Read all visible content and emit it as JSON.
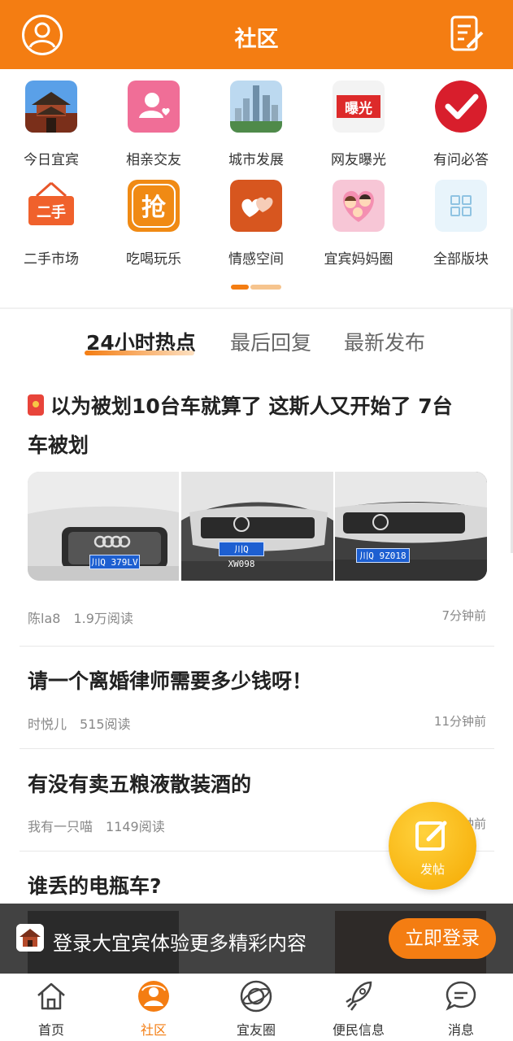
{
  "header": {
    "title": "社区",
    "profile_icon": "user-circle-icon",
    "compose_icon": "edit-note-icon"
  },
  "categories": [
    {
      "label": "今日宜宾",
      "icon": "city-tower-icon"
    },
    {
      "label": "相亲交友",
      "icon": "dating-icon"
    },
    {
      "label": "城市发展",
      "icon": "skyline-icon"
    },
    {
      "label": "网友曝光",
      "icon": "exposure-icon",
      "badge": "曝光"
    },
    {
      "label": "有问必答",
      "icon": "check-icon"
    },
    {
      "label": "二手市场",
      "icon": "second-hand-icon",
      "badge": "二手"
    },
    {
      "label": "吃喝玩乐",
      "icon": "grab-icon",
      "badge": "抢"
    },
    {
      "label": "情感空间",
      "icon": "hearts-icon"
    },
    {
      "label": "宜宾妈妈圈",
      "icon": "family-icon"
    },
    {
      "label": "全部版块",
      "icon": "grid-icon"
    }
  ],
  "tabs": [
    {
      "label": "24小时热点",
      "active": true
    },
    {
      "label": "最后回复",
      "active": false
    },
    {
      "label": "最新发布",
      "active": false
    }
  ],
  "posts": [
    {
      "title_line1": "以为被划10台车就算了  这斯人又开始了 7台",
      "title_line2": "车被划",
      "author": "陈la8",
      "reads": "1.9万阅读",
      "time": "7分钟前",
      "plates": [
        "川Q 379LV",
        "川Q XW098",
        "川Q 9Z018"
      ]
    },
    {
      "title": "请一个离婚律师需要多少钱呀！",
      "author": "时悦儿",
      "reads": "515阅读",
      "time": "11分钟前"
    },
    {
      "title": "有没有卖五粮液散装酒的",
      "author": "我有一只喵",
      "reads": "1149阅读",
      "time": "钟前"
    },
    {
      "title": "谁丢的电瓶车?"
    }
  ],
  "fab": {
    "label": "发帖",
    "icon": "compose-icon"
  },
  "login_banner": {
    "text": "登录大宜宾体验更多精彩内容",
    "button": "立即登录"
  },
  "bottom_nav": [
    {
      "label": "首页",
      "icon": "home-icon",
      "active": false
    },
    {
      "label": "社区",
      "icon": "community-icon",
      "active": true
    },
    {
      "label": "宜友圈",
      "icon": "planet-icon",
      "active": false
    },
    {
      "label": "便民信息",
      "icon": "rocket-icon",
      "active": false
    },
    {
      "label": "消息",
      "icon": "message-icon",
      "active": false
    }
  ],
  "colors": {
    "brand": "#f47d12",
    "text": "#222222",
    "muted": "#888888"
  }
}
